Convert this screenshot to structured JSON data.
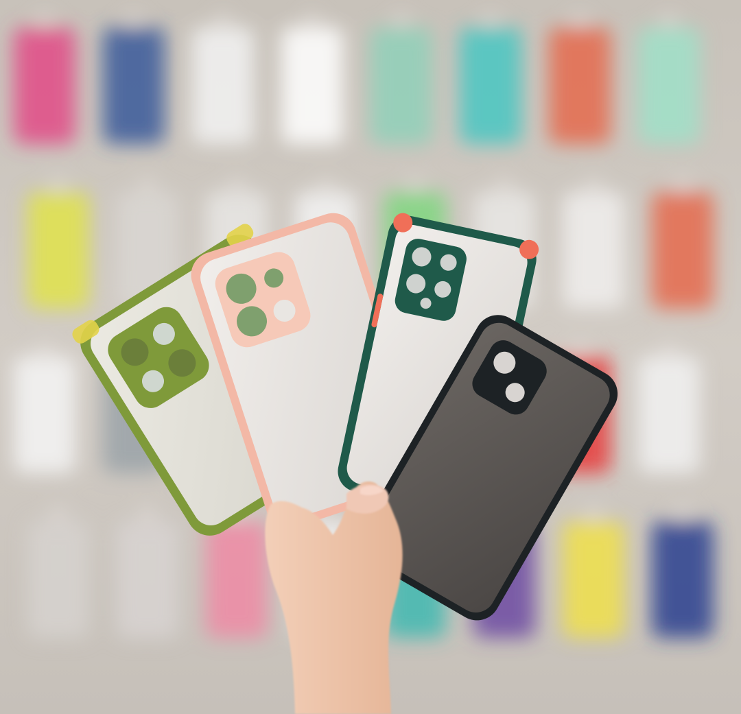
{
  "photo": {
    "subject": "hand-holding-phone-cases",
    "palette": {
      "wall": "#cfc9c2",
      "wall_shadow": "#b9b2aa",
      "olive_case": "#7f9a3a",
      "olive_bumper_accent": "#e2d34a",
      "pink_case": "#f3b8a6",
      "pink_camera": "#f6c9b8",
      "green_case": "#1f5a4a",
      "green_bumper_accent": "#f06f58",
      "black_case": "#1d2225",
      "frosted_back": "#e9e6e2",
      "smoke_back": "#5f5a57",
      "skin": "#efc6ad"
    },
    "cases": [
      {
        "color_name": "olive-green",
        "camera_holes": 4
      },
      {
        "color_name": "pink",
        "camera_holes": 4
      },
      {
        "color_name": "dark-green",
        "camera_holes": 5
      },
      {
        "color_name": "black",
        "camera_holes": 2
      }
    ],
    "background_tiles": [
      "#e24a86",
      "#3a5a9a",
      "#f2f2f2",
      "#ffffff",
      "#8fd0b8",
      "#49c7c2",
      "#e56a4e",
      "#9fe0c8",
      "#e0e34a",
      "#d9d6d2",
      "#e8e6e4",
      "#f2f2f2",
      "#7fd67f",
      "#e9e7e5",
      "#f0efed",
      "#e56a4e",
      "#f5f5f5",
      "#9aa2a8",
      "#f1f1f1",
      "#eaeaea",
      "#f4f4f4",
      "#e1e1e1",
      "#e73a3a",
      "#f1f1f1",
      "#d6d2cf",
      "#d8d4d1",
      "#ef8aa4",
      "#f0f0f0",
      "#3fb9b0",
      "#6c4aa2",
      "#f0e04a",
      "#2a3f8f"
    ]
  }
}
